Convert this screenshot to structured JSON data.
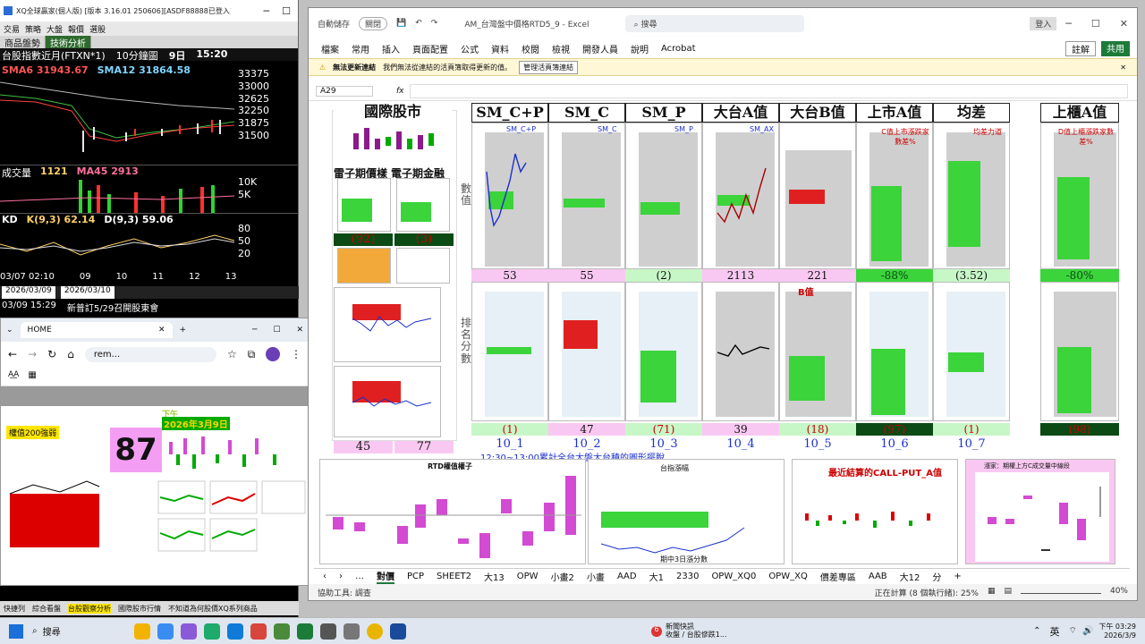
{
  "xq": {
    "title": "XQ全球贏家(個人版) [版本 3.16.01 250606][ASDF88888已登入]...",
    "menu": [
      "交易",
      "策略",
      "大盤",
      "報價",
      "選股"
    ],
    "tabs": [
      "商品盤勢",
      "技術分析"
    ],
    "symbol": "台股指數近月(FTXN*1)",
    "period": "10分鐘圖",
    "day": "9日",
    "time": "15:20",
    "sma6": "SMA6 31943.67",
    "sma12": "SMA12 31864.58",
    "price_axis": [
      "33375",
      "33000",
      "32625",
      "32250",
      "31875",
      "31500"
    ],
    "vol_label": "成交量",
    "vol_value": "1121",
    "ma45": "MA45 2913",
    "vol_axis": [
      "10K",
      "5K"
    ],
    "kd_label": "KD",
    "k_value": "K(9,3) 62.14",
    "d_value": "D(9,3) 59.06",
    "kd_axis": [
      "80",
      "50",
      "20"
    ],
    "x_axis": [
      "03/07 02:10",
      "09",
      "10",
      "11",
      "12",
      "13"
    ],
    "date_from": "2026/03/09",
    "date_to": "2026/03/10",
    "ticker_time": "03/09 15:29",
    "ticker_news": "新普訂5/29召開股東會",
    "bottom_tabs": [
      "快捷列",
      "綜合看盤",
      "台股觀察分析",
      "國際股市行情",
      "不知道為何股價XQ系列商品"
    ]
  },
  "browser": {
    "tab_title": "HOME",
    "url": "rem...",
    "big_number": "87",
    "label_top": "權值200強弱",
    "banner": "2026年3月9日",
    "banner2": "下午"
  },
  "excel": {
    "autosave": "自動儲存",
    "toggle": "關閉",
    "filename": "AM_台灣盤中價格RTD5_9 - Excel",
    "search_placeholder": "搜尋",
    "user": "登入",
    "menus": [
      "檔案",
      "常用",
      "插入",
      "頁面配置",
      "公式",
      "資料",
      "校閱",
      "檢視",
      "開發人員",
      "說明",
      "Acrobat"
    ],
    "comment_btn": "註解",
    "share_btn": "共用",
    "warn_title": "無法更新連結",
    "warn_text": "我們無法從連結的活頁簿取得更新的值。",
    "warn_btn": "管理活頁簿連結",
    "name_box": "A29",
    "fx": "fx",
    "headers": [
      "國際股市",
      "SM_C+P",
      "SM_C",
      "SM_P",
      "大台A值",
      "大台B值",
      "上市A值",
      "均差",
      "上櫃A值"
    ],
    "side_labels": [
      "數值",
      "排名分數"
    ],
    "mid_labels": [
      "雷子期價樣",
      "電子期金融"
    ],
    "row1_values": [
      "53",
      "55",
      "(2)",
      "2113",
      "221",
      "-88%",
      "(3.52)",
      "-80%"
    ],
    "row2_values": [
      "(1)",
      "47",
      "(71)",
      "39",
      "(18)",
      "(97)",
      "(1)",
      "(98)"
    ],
    "left_values": [
      "(92)",
      "(3)",
      "45",
      "77"
    ],
    "col_labels": [
      "10_1",
      "10_2",
      "10_3",
      "10_4",
      "10_5",
      "10_6",
      "10_7"
    ],
    "chart_titles": [
      "SM_C+P",
      "SM_C",
      "SM_P",
      "SM_AX",
      "B值",
      "C值上市漲跌家數差%",
      "均差力道",
      "D值上櫃漲跌家數差%"
    ],
    "ticker_line": "12:30~13:00累計全台大盤大台積的圓形擺脫",
    "bottom_charts": [
      "RTD權值權子",
      "台指漲幅",
      "最近結算的CALL-PUT_A值",
      "漲家：期權上方C成交量中線段"
    ],
    "bottom_sub": "期中3日漲分數",
    "sheets": [
      "對價",
      "PCP",
      "SHEET2",
      "大13",
      "OPW",
      "小畫2",
      "小畫",
      "AAD",
      "大1",
      "2330",
      "OPW_XQ0",
      "OPW_XQ",
      "價差專區",
      "AAB",
      "大12",
      "分"
    ],
    "status_left": "協助工具: 調查",
    "status_calc": "正在計算 (8 個執行緒): 25%",
    "zoom": "40%"
  },
  "taskbar": {
    "search": "搜尋",
    "news_title": "新聞快訊",
    "news_sub": "收盤 / 台股慘跌1...",
    "lang": "英",
    "time": "下午 03:29",
    "date": "2026/3/9",
    "badge": "6"
  }
}
